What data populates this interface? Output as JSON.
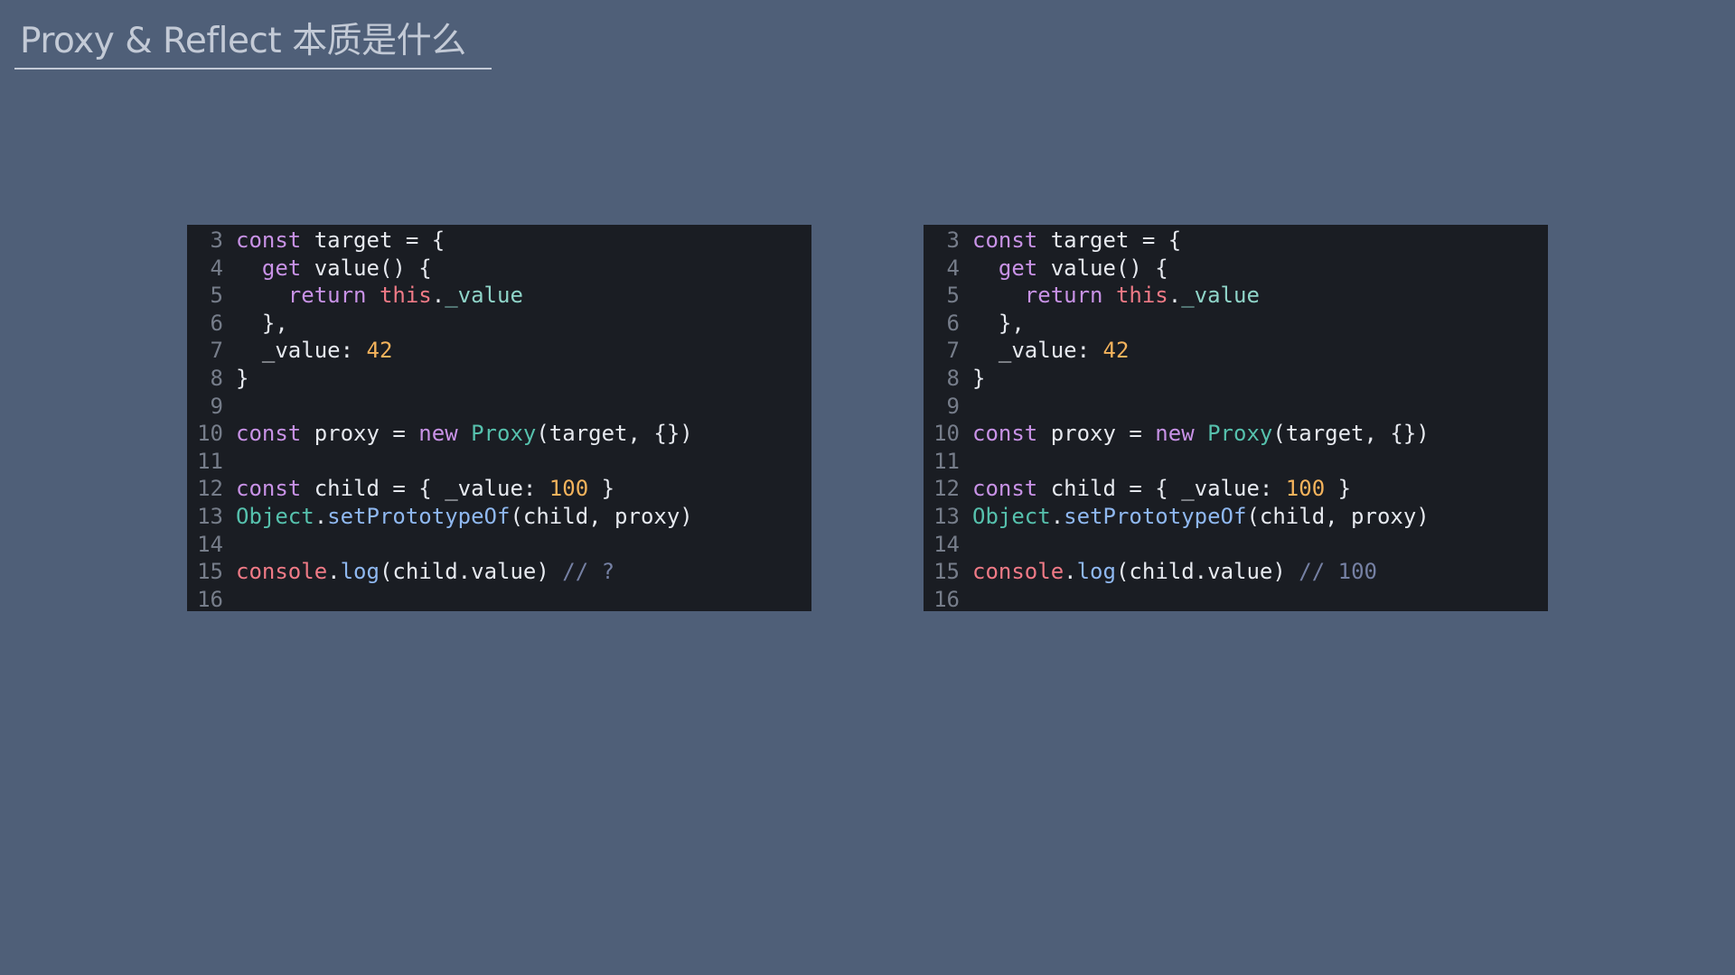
{
  "slide": {
    "title": "Proxy & Reflect 本质是什么"
  },
  "panels": [
    {
      "id": "left",
      "lines": [
        {
          "num": "3",
          "tokens": [
            {
              "t": "kw",
              "v": "const"
            },
            {
              "t": "plain",
              "v": " target = {"
            }
          ]
        },
        {
          "num": "4",
          "tokens": [
            {
              "t": "plain",
              "v": "  "
            },
            {
              "t": "kw",
              "v": "get"
            },
            {
              "t": "plain",
              "v": " value() {"
            }
          ]
        },
        {
          "num": "5",
          "tokens": [
            {
              "t": "plain",
              "v": "    "
            },
            {
              "t": "kw",
              "v": "return"
            },
            {
              "t": "plain",
              "v": " "
            },
            {
              "t": "this",
              "v": "this"
            },
            {
              "t": "plain",
              "v": "."
            },
            {
              "t": "prop",
              "v": "_value"
            }
          ]
        },
        {
          "num": "6",
          "tokens": [
            {
              "t": "plain",
              "v": "  },"
            }
          ]
        },
        {
          "num": "7",
          "tokens": [
            {
              "t": "plain",
              "v": "  _value: "
            },
            {
              "t": "num",
              "v": "42"
            }
          ]
        },
        {
          "num": "8",
          "tokens": [
            {
              "t": "plain",
              "v": "}"
            }
          ]
        },
        {
          "num": "9",
          "tokens": []
        },
        {
          "num": "10",
          "tokens": [
            {
              "t": "kw",
              "v": "const"
            },
            {
              "t": "plain",
              "v": " proxy = "
            },
            {
              "t": "kw",
              "v": "new"
            },
            {
              "t": "plain",
              "v": " "
            },
            {
              "t": "cls",
              "v": "Proxy"
            },
            {
              "t": "plain",
              "v": "(target, {})"
            }
          ]
        },
        {
          "num": "11",
          "tokens": []
        },
        {
          "num": "12",
          "tokens": [
            {
              "t": "kw",
              "v": "const"
            },
            {
              "t": "plain",
              "v": " child = { _value: "
            },
            {
              "t": "num",
              "v": "100"
            },
            {
              "t": "plain",
              "v": " }"
            }
          ]
        },
        {
          "num": "13",
          "tokens": [
            {
              "t": "obj",
              "v": "Object"
            },
            {
              "t": "plain",
              "v": "."
            },
            {
              "t": "fn",
              "v": "setPrototypeOf"
            },
            {
              "t": "plain",
              "v": "(child, proxy)"
            }
          ]
        },
        {
          "num": "14",
          "tokens": []
        },
        {
          "num": "15",
          "tokens": [
            {
              "t": "console",
              "v": "console"
            },
            {
              "t": "plain",
              "v": "."
            },
            {
              "t": "fn",
              "v": "log"
            },
            {
              "t": "plain",
              "v": "(child.value) "
            },
            {
              "t": "comment",
              "v": "// ?"
            }
          ]
        },
        {
          "num": "16",
          "tokens": []
        }
      ]
    },
    {
      "id": "right",
      "lines": [
        {
          "num": "3",
          "tokens": [
            {
              "t": "kw",
              "v": "const"
            },
            {
              "t": "plain",
              "v": " target = {"
            }
          ]
        },
        {
          "num": "4",
          "tokens": [
            {
              "t": "plain",
              "v": "  "
            },
            {
              "t": "kw",
              "v": "get"
            },
            {
              "t": "plain",
              "v": " value() {"
            }
          ]
        },
        {
          "num": "5",
          "tokens": [
            {
              "t": "plain",
              "v": "    "
            },
            {
              "t": "kw",
              "v": "return"
            },
            {
              "t": "plain",
              "v": " "
            },
            {
              "t": "this",
              "v": "this"
            },
            {
              "t": "plain",
              "v": "."
            },
            {
              "t": "prop",
              "v": "_value"
            }
          ]
        },
        {
          "num": "6",
          "tokens": [
            {
              "t": "plain",
              "v": "  },"
            }
          ]
        },
        {
          "num": "7",
          "tokens": [
            {
              "t": "plain",
              "v": "  _value: "
            },
            {
              "t": "num",
              "v": "42"
            }
          ]
        },
        {
          "num": "8",
          "tokens": [
            {
              "t": "plain",
              "v": "}"
            }
          ]
        },
        {
          "num": "9",
          "tokens": []
        },
        {
          "num": "10",
          "tokens": [
            {
              "t": "kw",
              "v": "const"
            },
            {
              "t": "plain",
              "v": " proxy = "
            },
            {
              "t": "kw",
              "v": "new"
            },
            {
              "t": "plain",
              "v": " "
            },
            {
              "t": "cls",
              "v": "Proxy"
            },
            {
              "t": "plain",
              "v": "(target, {})"
            }
          ]
        },
        {
          "num": "11",
          "tokens": []
        },
        {
          "num": "12",
          "tokens": [
            {
              "t": "kw",
              "v": "const"
            },
            {
              "t": "plain",
              "v": " child = { _value: "
            },
            {
              "t": "num",
              "v": "100"
            },
            {
              "t": "plain",
              "v": " }"
            }
          ]
        },
        {
          "num": "13",
          "tokens": [
            {
              "t": "obj",
              "v": "Object"
            },
            {
              "t": "plain",
              "v": "."
            },
            {
              "t": "fn",
              "v": "setPrototypeOf"
            },
            {
              "t": "plain",
              "v": "(child, proxy)"
            }
          ]
        },
        {
          "num": "14",
          "tokens": []
        },
        {
          "num": "15",
          "tokens": [
            {
              "t": "console",
              "v": "console"
            },
            {
              "t": "plain",
              "v": "."
            },
            {
              "t": "fn",
              "v": "log"
            },
            {
              "t": "plain",
              "v": "(child.value) "
            },
            {
              "t": "comment",
              "v": "// 100"
            }
          ]
        },
        {
          "num": "16",
          "tokens": []
        }
      ]
    }
  ]
}
